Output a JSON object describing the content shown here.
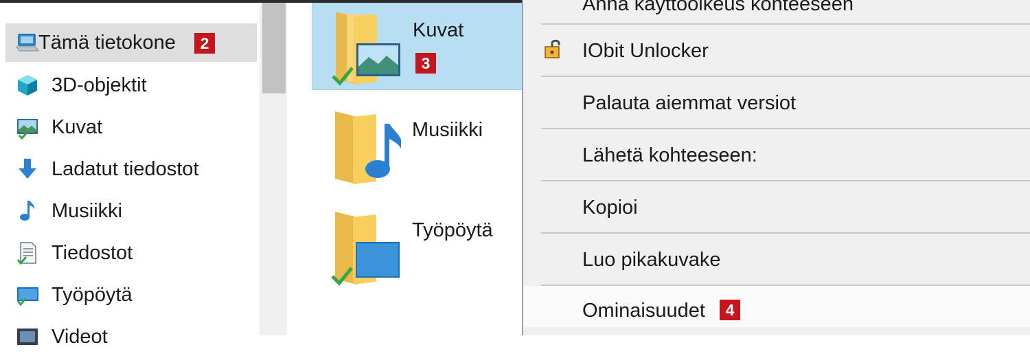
{
  "navigation": {
    "items": [
      {
        "label": "Tämä tietokone",
        "icon": "computer-icon",
        "selected": true,
        "badge": "2"
      },
      {
        "label": "3D-objektit",
        "icon": "cube-3d-icon"
      },
      {
        "label": "Kuvat",
        "icon": "pictures-icon"
      },
      {
        "label": "Ladatut tiedostot",
        "icon": "download-arrow-icon"
      },
      {
        "label": "Musiikki",
        "icon": "music-note-icon"
      },
      {
        "label": "Tiedostot",
        "icon": "documents-icon"
      },
      {
        "label": "Työpöytä",
        "icon": "desktop-icon"
      },
      {
        "label": "Videot",
        "icon": "video-icon"
      }
    ]
  },
  "content": {
    "tiles": [
      {
        "label": "Kuvat",
        "icon": "pictures-folder-icon",
        "selected": true,
        "badge": "3",
        "synced": true
      },
      {
        "label": "Musiikki",
        "icon": "music-folder-icon",
        "selected": false,
        "synced": false
      },
      {
        "label": "Työpöytä",
        "icon": "desktop-folder-icon",
        "selected": false,
        "synced": true
      }
    ]
  },
  "context_menu": {
    "items": [
      {
        "label": "Anna käyttöoikeus kohteeseen"
      },
      {
        "label": "IObit Unlocker",
        "icon": "padlock-icon"
      },
      {
        "label": "Palauta aiemmat versiot"
      },
      {
        "label": "Lähetä kohteeseen:"
      },
      {
        "label": "Kopioi"
      },
      {
        "label": "Luo pikakuvake"
      },
      {
        "label": "Ominaisuudet",
        "badge": "4",
        "hovered": true
      }
    ]
  },
  "colors": {
    "badge": "#c4161c",
    "selection": "#b8def4",
    "nav_selection": "#dedede",
    "folder": "#f6cf5f",
    "sync_check": "#3aa34a"
  }
}
